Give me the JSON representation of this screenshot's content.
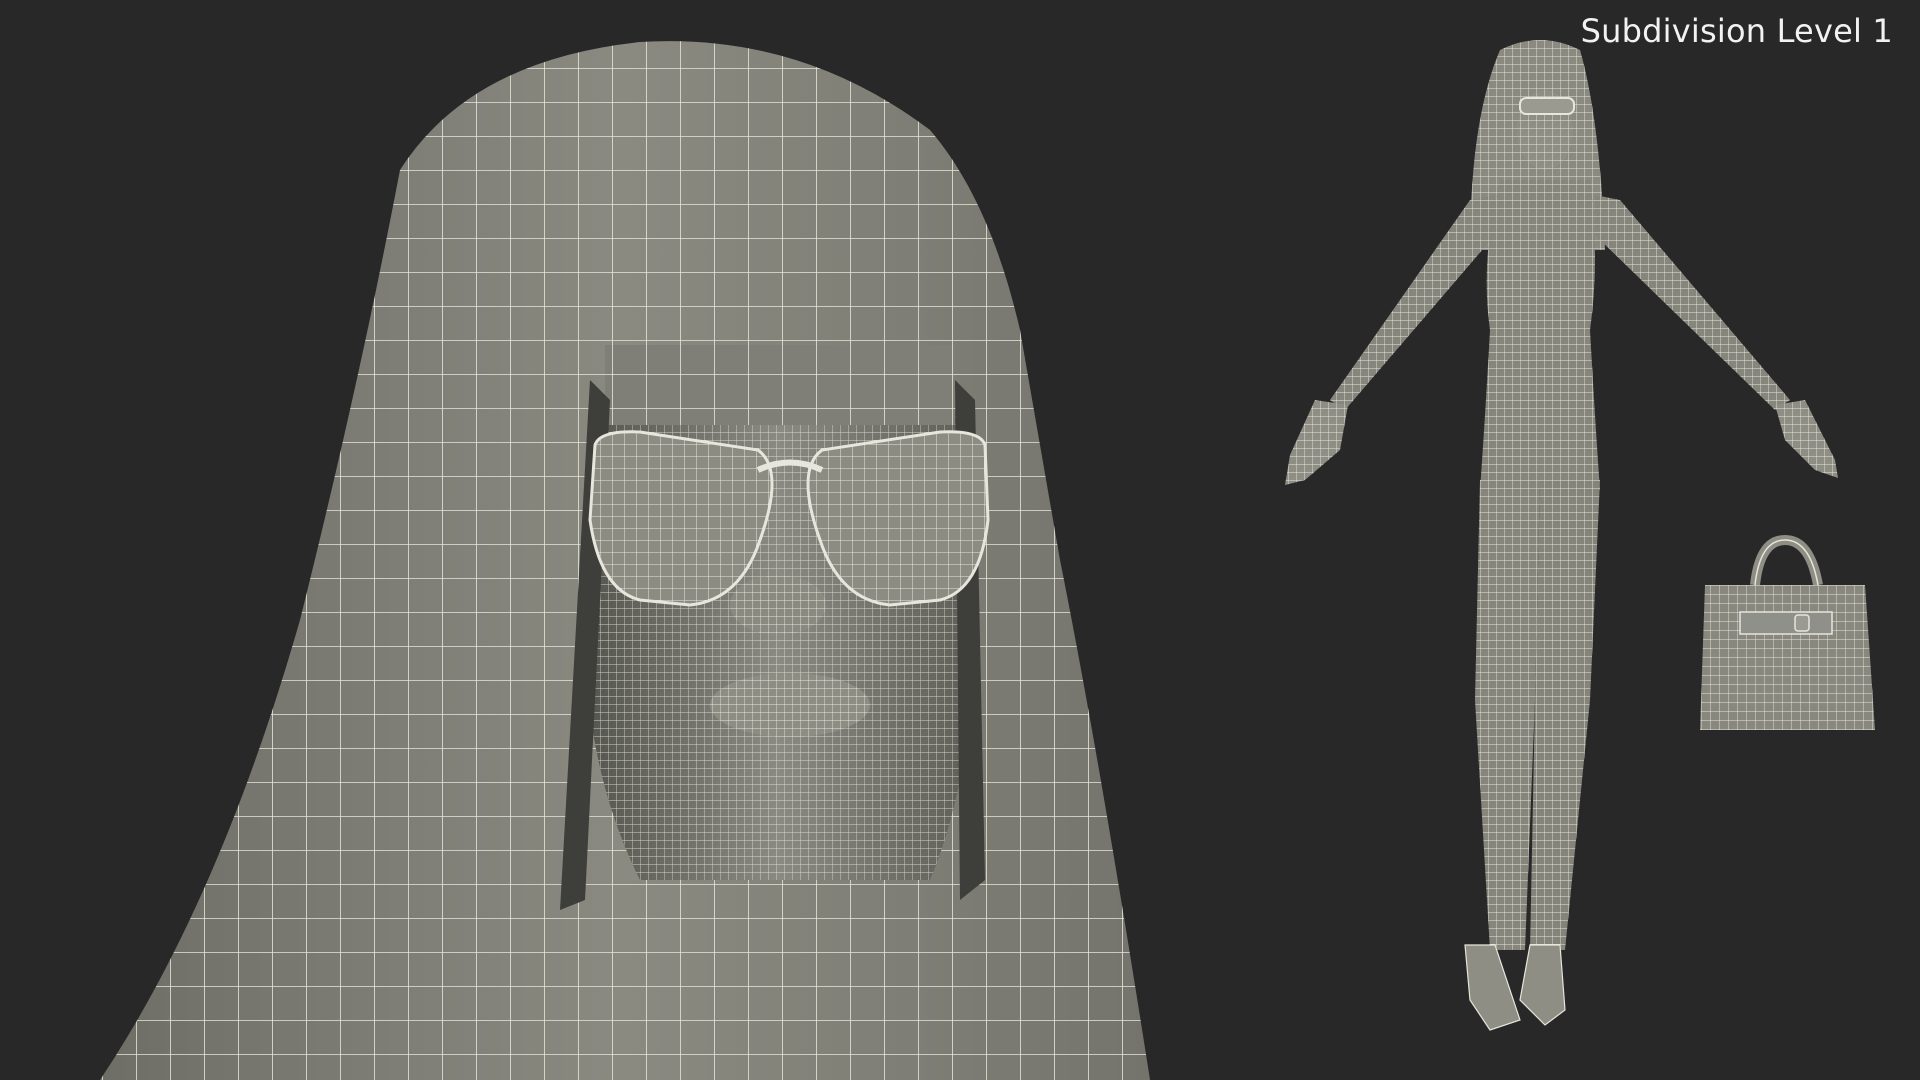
{
  "viewport": {
    "label": "Subdivision Level 1"
  },
  "colors": {
    "background": "#282828",
    "mesh_fill": "#82827a",
    "mesh_fill_light": "#8e8e85",
    "mesh_shadow": "#62625b",
    "wire": "#e6e6dc",
    "label_text": "#f2f2f2"
  },
  "scene_objects": [
    "head-closeup-wireframe",
    "full-body-figure-wireframe",
    "handbag-wireframe"
  ]
}
